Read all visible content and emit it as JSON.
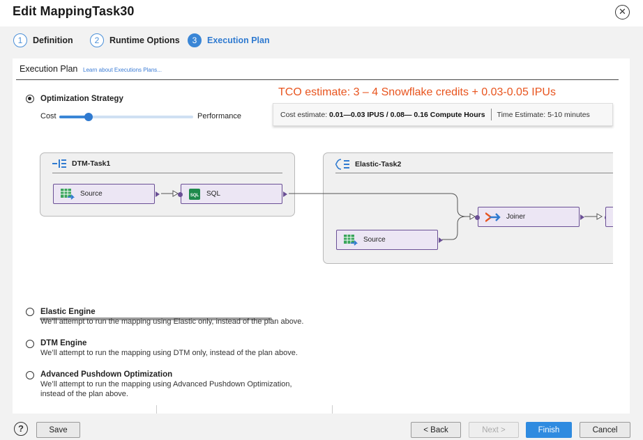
{
  "dialog": {
    "title": "Edit MappingTask30",
    "close_icon": "close-icon"
  },
  "steps": [
    {
      "num": "1",
      "label": "Definition",
      "active": false
    },
    {
      "num": "2",
      "label": "Runtime Options",
      "active": false
    },
    {
      "num": "3",
      "label": "Execution Plan",
      "active": true
    }
  ],
  "section": {
    "title": "Execution Plan",
    "link": "Learn about Executions Plans..."
  },
  "tco_estimate": "TCO estimate: 3 – 4 Snowflake credits + 0.03-0.05 IPUs",
  "cost_box": {
    "cost_label": "Cost estimate:",
    "cost_value": "0.01—0.03 IPUS / 0.08— 0.16 Compute Hours",
    "time_label": "Time Estimate:",
    "time_value": "5-10 minutes"
  },
  "optimization": {
    "title": "Optimization Strategy",
    "selected": true,
    "slider_left_label": "Cost",
    "slider_right_label": "Performance",
    "slider_value": 0.22
  },
  "diagram": {
    "groups": [
      {
        "name": "DTM-Task1",
        "icon": "dtm-task-icon",
        "nodes": [
          {
            "label": "Source",
            "icon": "source-table-icon"
          },
          {
            "label": "SQL",
            "icon": "sql-icon"
          }
        ]
      },
      {
        "name": "Elastic-Task2",
        "icon": "elastic-task-icon",
        "nodes": [
          {
            "label": "Joiner",
            "icon": "joiner-icon"
          },
          {
            "label": "Source",
            "icon": "source-table-icon"
          }
        ]
      }
    ]
  },
  "options": [
    {
      "title": "Elastic Engine",
      "desc": "We’ll attempt to run the mapping using Elastic only, instead of the plan above.",
      "selected": false
    },
    {
      "title": "DTM Engine",
      "desc": "We’ll attempt to run the mapping using DTM only, instead of the plan above.",
      "selected": false
    },
    {
      "title": "Advanced Pushdown Optimization",
      "desc1": "We’ll attempt to run the mapping using Advanced Pushdown Optimization,",
      "desc2": "instead of the plan above.",
      "selected": false
    }
  ],
  "footer": {
    "help_icon": "help-icon",
    "save": "Save",
    "back": "< Back",
    "next": "Next >",
    "finish": "Finish",
    "cancel": "Cancel"
  },
  "colors": {
    "accent": "#2f8be0",
    "tco": "#e8541e",
    "node_fill": "#ece6f4",
    "node_border": "#6a4f95"
  }
}
